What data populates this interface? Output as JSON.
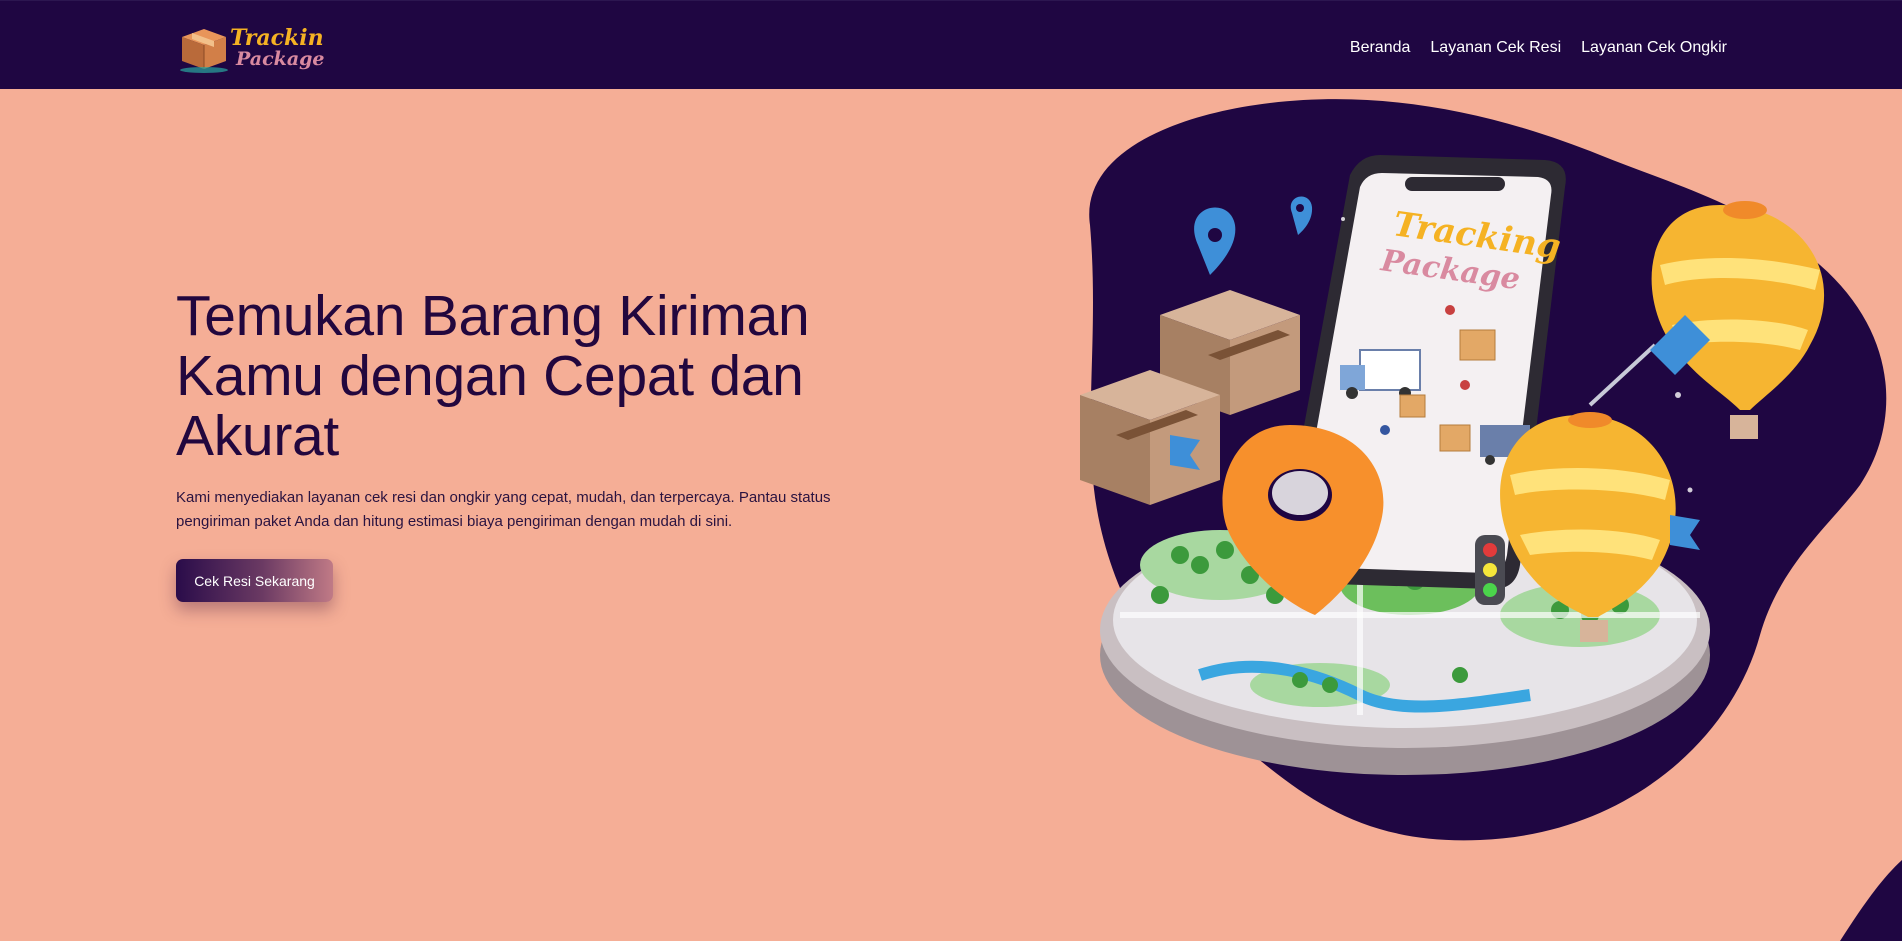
{
  "navbar": {
    "logo": {
      "line1": "Tracking",
      "line2": "Package",
      "icon": "package-box-icon"
    },
    "links": [
      {
        "label": "Beranda"
      },
      {
        "label": "Layanan Cek Resi"
      },
      {
        "label": "Layanan Cek Ongkir"
      }
    ]
  },
  "hero": {
    "title": "Temukan Barang Kiriman Kamu dengan Cepat dan Akurat",
    "description": "Kami menyediakan layanan cek resi dan ongkir yang cepat, mudah, dan terpercaya. Pantau status pengiriman paket Anda dan hitung estimasi biaya pengiriman dengan mudah di sini.",
    "cta_label": "Cek Resi Sekarang"
  },
  "illustration": {
    "phone_text_line1": "Tracking",
    "phone_text_line2": "Package"
  },
  "colors": {
    "background": "#f5ae96",
    "navbar": "#1f0642",
    "title": "#22073e",
    "blob": "#1f0642"
  }
}
